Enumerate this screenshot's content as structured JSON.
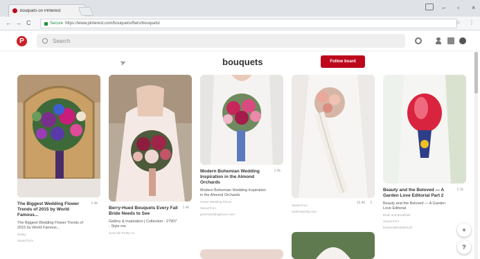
{
  "browser": {
    "tab_title": "bouquets on Pinterest",
    "tab_close": "×",
    "window": {
      "minimize": "–",
      "maximize": "▫",
      "close": "×"
    },
    "nav": {
      "back": "←",
      "forward": "→",
      "reload": "C"
    },
    "secure_label": "Secure",
    "url": "https://www.pinterest.com/bouquetsrflwrs/bouquets/",
    "star": "☆",
    "menu": "⋮"
  },
  "header": {
    "logo": "P",
    "search_placeholder": "Search"
  },
  "board": {
    "title": "bouquets",
    "follow_label": "Follow board"
  },
  "pins": [
    {
      "title": "The Biggest Wedding Flower Trends of 2015 by World Famous...",
      "stat": "2.4k",
      "desc": "The Biggest Wedding Flower Trends of 2015 by World Famous...",
      "meta": "Bridey",
      "meta2": "Saved from"
    },
    {
      "title": "Berry-Hued Bouquets Every Fall Bride Needs to See",
      "stat": "1.4k",
      "desc": "Gallery & Inspiration | Collection - 27907 - Style me",
      "meta": "Suits Me Pretty Co"
    },
    {
      "title": "Modern Bohemian Wedding Inspiration in the Almond Orchards",
      "stat": "1.4k",
      "desc": "Modern Bohemian Wedding Inspiration in the Almond Orchards",
      "meta": "Green Wedding Shoes",
      "meta2": "Saved from",
      "meta3": "greenweddingshoes.com"
    },
    {
      "stat": "15.4k",
      "stat2": "3",
      "meta": "Saved from",
      "meta2": "stylemepretty.com"
    },
    {
      "title": "Beauty and the Beloved — A Garden Love Editorial Part 2",
      "stat": "2.1k",
      "desc": "Beauty and the Beloved — A Garden Love Editorial",
      "meta": "Bride and Breakfast",
      "meta2": "Saved from",
      "meta3": "brideandbreakfast.ph"
    }
  ],
  "fab": {
    "add": "+",
    "help": "?"
  },
  "colors": {
    "pinterest_red": "#bd081c",
    "secure_green": "#1e8e3e"
  }
}
